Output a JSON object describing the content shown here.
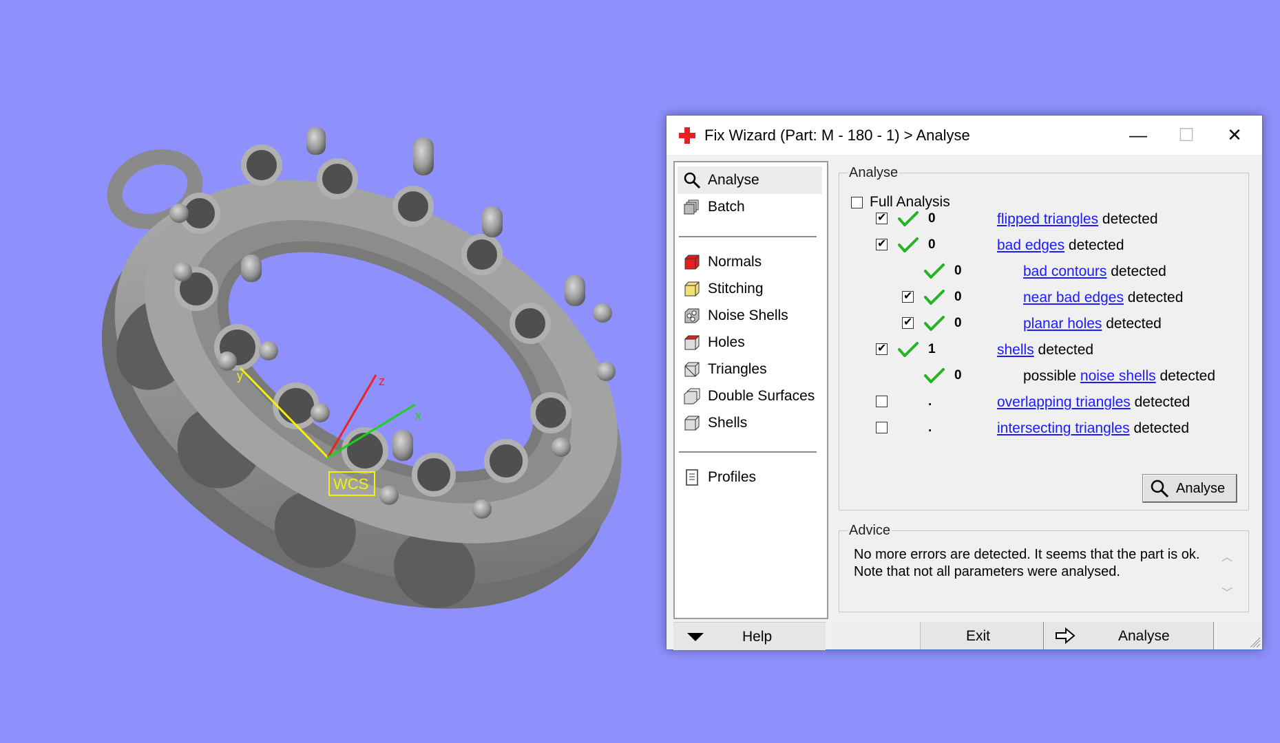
{
  "window": {
    "title": "Fix Wizard (Part: M - 180 - 1) > Analyse",
    "controls": {
      "minimize": "—",
      "maximize": "☐",
      "close": "✕"
    }
  },
  "viewport": {
    "wcs_label": "WCS",
    "axis_labels": {
      "x": "x",
      "y": "y",
      "z": "z"
    },
    "colors": {
      "background": "#8e90fb",
      "x_axis": "#19d419",
      "y_axis": "#f2f20a",
      "z_axis": "#ee2222"
    }
  },
  "sidebar": {
    "top_items": [
      {
        "label": "Analyse",
        "icon": "magnifier-icon",
        "active": true
      },
      {
        "label": "Batch",
        "icon": "batch-icon",
        "active": false
      }
    ],
    "fix_items": [
      {
        "label": "Normals",
        "icon": "normals-cube-icon"
      },
      {
        "label": "Stitching",
        "icon": "stitching-cube-icon"
      },
      {
        "label": "Noise Shells",
        "icon": "noise-shells-icon"
      },
      {
        "label": "Holes",
        "icon": "holes-cube-icon"
      },
      {
        "label": "Triangles",
        "icon": "triangles-cube-icon"
      },
      {
        "label": "Double Surfaces",
        "icon": "double-surfaces-icon"
      },
      {
        "label": "Shells",
        "icon": "shells-cube-icon"
      }
    ],
    "bottom_items": [
      {
        "label": "Profiles",
        "icon": "profiles-icon"
      }
    ],
    "help_label": "Help"
  },
  "analyse": {
    "group_label": "Analyse",
    "full_analysis_label": "Full Analysis",
    "full_analysis_checked": false,
    "detected_word": "detected",
    "possible_word": "possible",
    "rows": [
      {
        "checked": true,
        "ok": true,
        "count": "0",
        "link": "flipped triangles"
      },
      {
        "checked": true,
        "ok": true,
        "count": "0",
        "link": "bad edges"
      },
      {
        "checked": null,
        "ok": true,
        "count": "0",
        "link": "bad contours"
      },
      {
        "checked": true,
        "ok": true,
        "count": "0",
        "link": "near bad edges"
      },
      {
        "checked": true,
        "ok": true,
        "count": "0",
        "link": "planar holes"
      },
      {
        "checked": true,
        "ok": true,
        "count": "1",
        "link": "shells"
      },
      {
        "checked": null,
        "ok": true,
        "count": "0",
        "link": "noise shells"
      },
      {
        "checked": false,
        "ok": false,
        "count": ".",
        "link": "overlapping triangles"
      },
      {
        "checked": false,
        "ok": false,
        "count": ".",
        "link": "intersecting triangles"
      }
    ],
    "analyse_button": "Analyse"
  },
  "advice": {
    "group_label": "Advice",
    "text": "No more errors are detected. It seems that the part is ok. Note that not all parameters were analysed."
  },
  "footer": {
    "exit_label": "Exit",
    "next_label": "Analyse"
  }
}
